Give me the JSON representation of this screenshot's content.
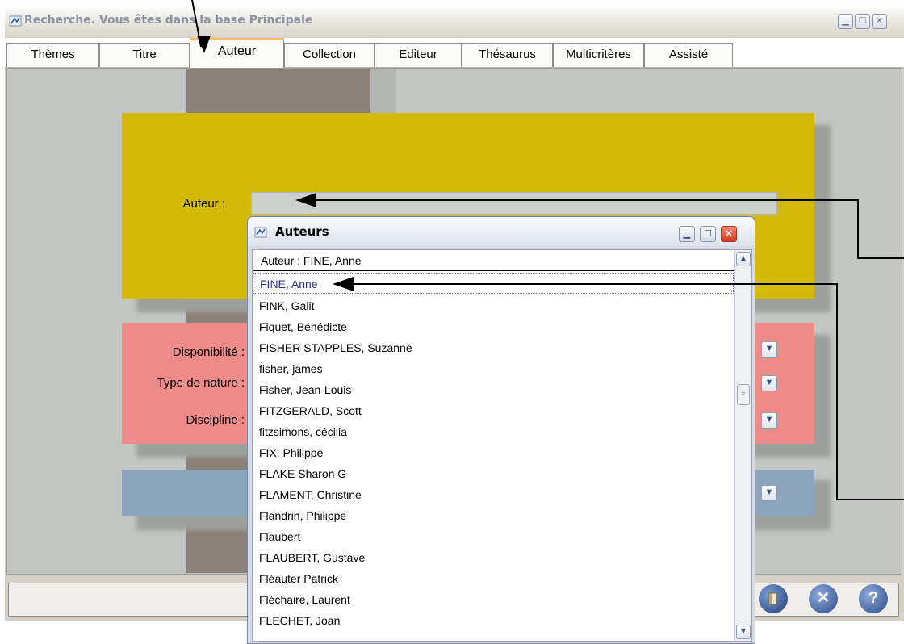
{
  "window": {
    "title": "Recherche. Vous êtes dans la base Principale",
    "icon": "app-logo-icon",
    "controls": [
      "minimize-icon",
      "maximize-icon",
      "close-icon"
    ]
  },
  "tabs": [
    {
      "label": "Thèmes"
    },
    {
      "label": "Titre"
    },
    {
      "label": "Auteur",
      "active": true
    },
    {
      "label": "Collection"
    },
    {
      "label": "Editeur"
    },
    {
      "label": "Thésaurus"
    },
    {
      "label": "Multicritères"
    },
    {
      "label": "Assisté"
    }
  ],
  "form": {
    "auteur_label": "Auteur :",
    "auteur_value": "",
    "disponibilite_label": "Disponibilité :",
    "type_nature_label": "Type de nature :",
    "discipline_label": "Discipline :"
  },
  "popup": {
    "title": "Auteurs",
    "header": "Auteur  : FINE, Anne",
    "items": [
      "FINE, Anne",
      "FINK, Galit",
      "Fiquet, Bénédicte",
      "FISHER STAPPLES, Suzanne",
      "fisher, james",
      "Fisher, Jean-Louis",
      "FITZGERALD, Scott",
      "fitzsimons, cécilia",
      "FIX, Philippe",
      "FLAKE Sharon G",
      "FLAMENT, Christine",
      "Flandrin, Philippe",
      "Flaubert",
      "FLAUBERT, Gustave",
      "Fléauter Patrick",
      "Fléchaire, Laurent",
      "FLECHET, Joan"
    ],
    "selected": "FINE, Anne"
  },
  "colors": {
    "yellow_panel": "#d3b90a",
    "pink_panel": "#f08a88",
    "blue_panel": "#8da4bd",
    "selected_text": "#2d2f86",
    "active_tab_accent": "#f4c067"
  },
  "status_buttons": [
    "book-icon",
    "cancel-icon",
    "help-icon"
  ]
}
